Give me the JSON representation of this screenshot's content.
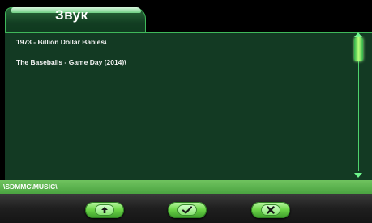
{
  "tab": {
    "title": "Звук"
  },
  "files": [
    {
      "label": "1973 - Billion Dollar Babies\\"
    },
    {
      "label": "The Baseballs - Game Day (2014)\\"
    }
  ],
  "path": "\\SDMMC\\MUSIC\\",
  "icons": {
    "up": "arrow-up-icon",
    "ok": "checkmark-icon",
    "close": "close-icon"
  },
  "colors": {
    "panel": "#133a23",
    "accent": "#3fb85a",
    "path_bar": "#5db44f",
    "button": "#6fd84a"
  }
}
